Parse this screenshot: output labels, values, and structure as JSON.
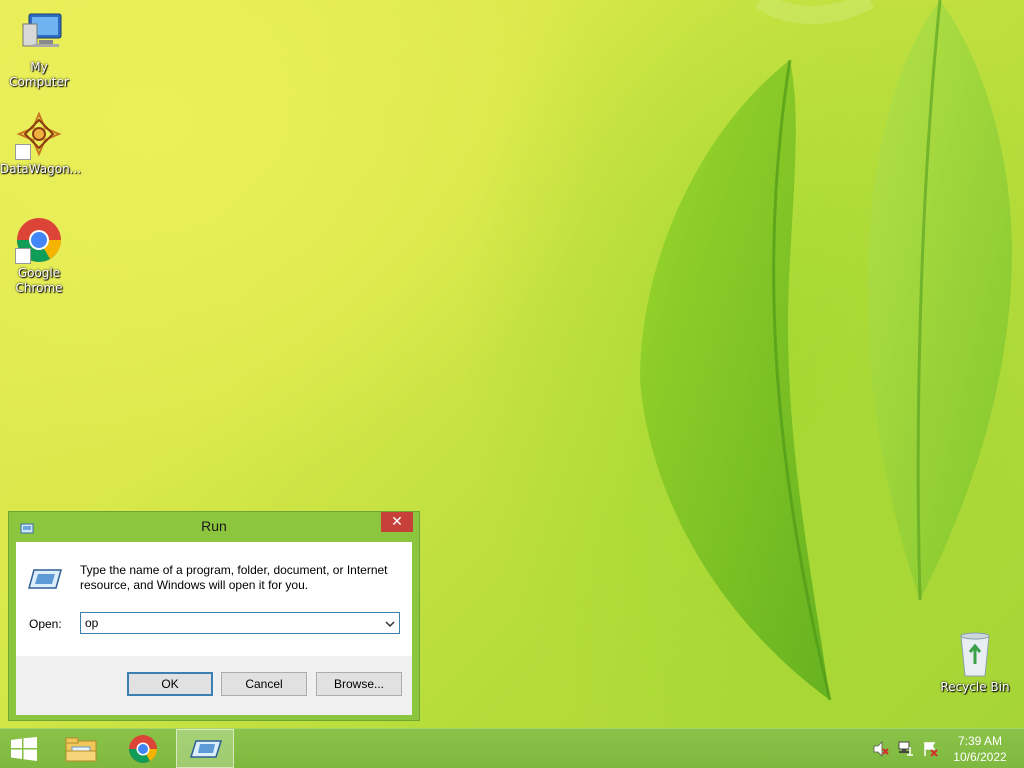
{
  "desktop": {
    "icons": [
      {
        "label": "My Computer",
        "icon": "computer-icon"
      },
      {
        "label": "DataWagon...",
        "icon": "datawagon-icon"
      },
      {
        "label": "Google Chrome",
        "icon": "chrome-icon"
      },
      {
        "label": "Recycle Bin",
        "icon": "recycle-bin-icon"
      }
    ]
  },
  "run_dialog": {
    "title": "Run",
    "close_glyph": "✕",
    "description": "Type the name of a program, folder, document, or Internet resource, and Windows will open it for you.",
    "open_label": "Open:",
    "open_value": "op",
    "buttons": {
      "ok": "OK",
      "cancel": "Cancel",
      "browse": "Browse..."
    }
  },
  "taskbar": {
    "items": [
      "start-icon",
      "file-explorer-icon",
      "chrome-icon",
      "run-icon"
    ],
    "active_item": "run-icon",
    "tray": [
      "volume-muted-icon",
      "network-icon",
      "action-center-icon"
    ],
    "time": "7:39 AM",
    "date": "10/6/2022"
  },
  "colors": {
    "taskbar": "#8bc34a",
    "window_frame": "#8cc63f",
    "close_button": "#c7403a",
    "accent_border": "#3c7fb1"
  }
}
